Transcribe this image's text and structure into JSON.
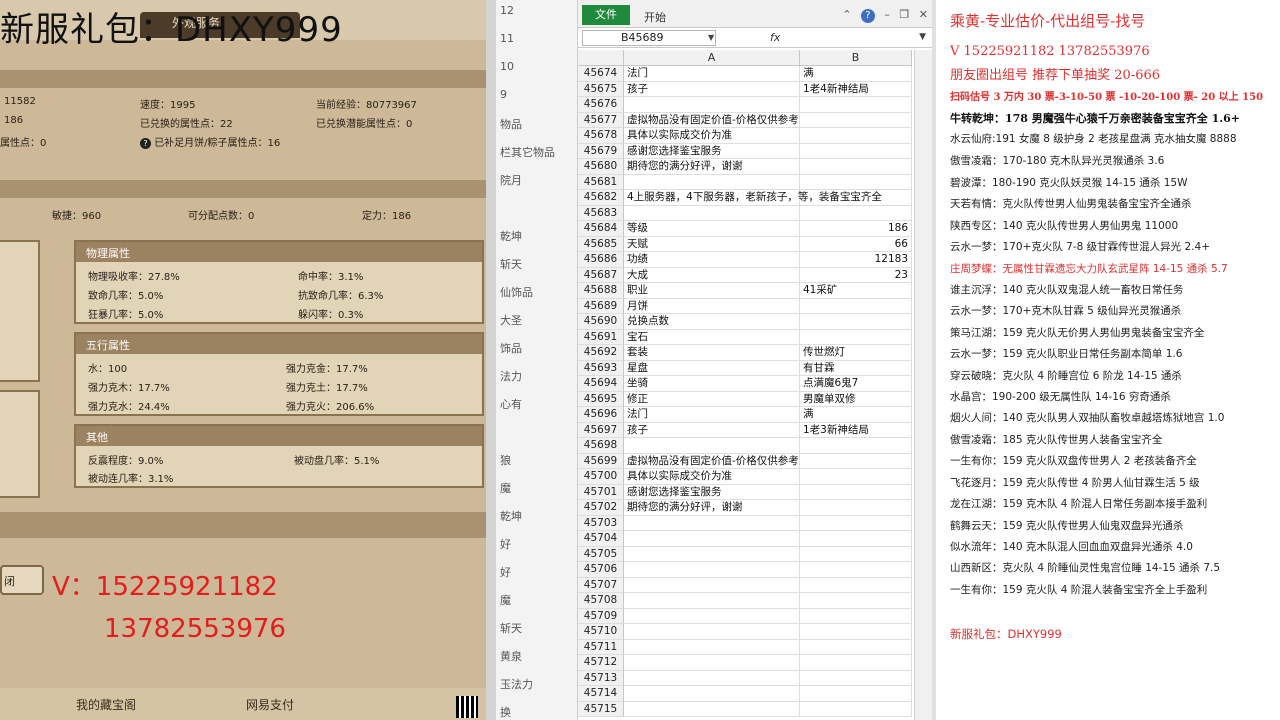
{
  "game": {
    "title": "新服礼包：DHXY999",
    "tab": "外观服务",
    "stats_row1": [
      "11582",
      "速度：1995",
      "当前经验：80773967"
    ],
    "stats_row2": [
      "186",
      "已兑换的属性点：22",
      "已兑换潜能属性点：0"
    ],
    "stats_row3": [
      "属性点：0",
      "已补足月饼/粽子属性点：16"
    ],
    "stats_row4": [
      "敏捷：960",
      "可分配点数：0",
      "定力：186"
    ],
    "physical": {
      "title": "物理属性",
      "items": [
        "物理吸收率：27.8%",
        "命中率：3.1%",
        "致命几率：5.0%",
        "抗致命几率：6.3%",
        "狂暴几率：5.0%",
        "躲闪率：0.3%"
      ]
    },
    "elements": {
      "title": "五行属性",
      "items": [
        "水：100",
        "强力克金：17.7%",
        "强力克木：17.7%",
        "强力克土：17.7%",
        "强力克水：24.4%",
        "强力克火：206.6%"
      ]
    },
    "other": {
      "title": "其他",
      "items": [
        "反震程度：9.0%",
        "被动盘几率：5.1%",
        "被动连几率：3.1%"
      ]
    },
    "close_label": "闭",
    "phone1": "V：15225921182",
    "phone2": "13782553976",
    "footer_left": "我的藏宝阁",
    "footer_right": "网易支付"
  },
  "strip": {
    "items": [
      "12",
      "11",
      "10",
      "9",
      "物品",
      "栏其它物品",
      "院月",
      "乾坤",
      "斩天",
      "仙饰品",
      "大圣",
      "饰品",
      "法力",
      "心有",
      "狼",
      "魔",
      "乾坤",
      "好",
      "好",
      "魔",
      "斩天",
      "黄泉",
      "玉法力",
      "换"
    ]
  },
  "excel": {
    "file_tab": "文件",
    "home_tab": "开始",
    "name_box": "B45689",
    "fx": "fx",
    "col_a": "A",
    "col_b": "B",
    "rows": [
      {
        "n": "45674",
        "a": "法门",
        "b": "满",
        "num": false
      },
      {
        "n": "45675",
        "a": "孩子",
        "b": "1老4新神结局",
        "num": false
      },
      {
        "n": "45676",
        "a": "",
        "b": "",
        "num": false
      },
      {
        "n": "45677",
        "a": "虚拟物品没有固定价值-价格仅供参考",
        "b": "",
        "num": false
      },
      {
        "n": "45678",
        "a": "具体以实际成交价为准",
        "b": "",
        "num": false
      },
      {
        "n": "45679",
        "a": "感谢您选择鉴宝服务",
        "b": "",
        "num": false
      },
      {
        "n": "45680",
        "a": "期待您的满分好评，谢谢",
        "b": "",
        "num": false
      },
      {
        "n": "45681",
        "a": "",
        "b": "",
        "num": false
      },
      {
        "n": "45682",
        "a": "4上服务器，4下服务器，老新孩子，等，装备宝宝齐全",
        "b": "",
        "num": false
      },
      {
        "n": "45683",
        "a": "",
        "b": "",
        "num": false
      },
      {
        "n": "45684",
        "a": "等级",
        "b": "186",
        "num": true
      },
      {
        "n": "45685",
        "a": "天赋",
        "b": "66",
        "num": true
      },
      {
        "n": "45686",
        "a": "功绩",
        "b": "12183",
        "num": true
      },
      {
        "n": "45687",
        "a": "大成",
        "b": "23",
        "num": true
      },
      {
        "n": "45688",
        "a": "职业",
        "b": "41采矿",
        "num": false
      },
      {
        "n": "45689",
        "a": "月饼",
        "b": "",
        "num": false
      },
      {
        "n": "45690",
        "a": "兑换点数",
        "b": "",
        "num": false
      },
      {
        "n": "45691",
        "a": "宝石",
        "b": "",
        "num": false
      },
      {
        "n": "45692",
        "a": "套装",
        "b": "传世燃灯",
        "num": false
      },
      {
        "n": "45693",
        "a": "星盘",
        "b": "有甘霖",
        "num": false
      },
      {
        "n": "45694",
        "a": "坐骑",
        "b": "点满魔6鬼7",
        "num": false
      },
      {
        "n": "45695",
        "a": "修正",
        "b": "男魔单双修",
        "num": false
      },
      {
        "n": "45696",
        "a": "法门",
        "b": "满",
        "num": false
      },
      {
        "n": "45697",
        "a": "孩子",
        "b": "1老3新神结局",
        "num": false
      },
      {
        "n": "45698",
        "a": "",
        "b": "",
        "num": false
      },
      {
        "n": "45699",
        "a": "虚拟物品没有固定价值-价格仅供参考",
        "b": "",
        "num": false
      },
      {
        "n": "45700",
        "a": "具体以实际成交价为准",
        "b": "",
        "num": false
      },
      {
        "n": "45701",
        "a": "感谢您选择鉴宝服务",
        "b": "",
        "num": false
      },
      {
        "n": "45702",
        "a": "期待您的满分好评，谢谢",
        "b": "",
        "num": false
      },
      {
        "n": "45703",
        "a": "",
        "b": "",
        "num": false
      },
      {
        "n": "45704",
        "a": "",
        "b": "",
        "num": false
      },
      {
        "n": "45705",
        "a": "",
        "b": "",
        "num": false
      },
      {
        "n": "45706",
        "a": "",
        "b": "",
        "num": false
      },
      {
        "n": "45707",
        "a": "",
        "b": "",
        "num": false
      },
      {
        "n": "45708",
        "a": "",
        "b": "",
        "num": false
      },
      {
        "n": "45709",
        "a": "",
        "b": "",
        "num": false
      },
      {
        "n": "45710",
        "a": "",
        "b": "",
        "num": false
      },
      {
        "n": "45711",
        "a": "",
        "b": "",
        "num": false
      },
      {
        "n": "45712",
        "a": "",
        "b": "",
        "num": false
      },
      {
        "n": "45713",
        "a": "",
        "b": "",
        "num": false
      },
      {
        "n": "45714",
        "a": "",
        "b": "",
        "num": false
      },
      {
        "n": "45715",
        "a": "",
        "b": "",
        "num": false
      }
    ]
  },
  "notes": {
    "lines": [
      {
        "text": "乘黄-专业估价-代出组号-找号",
        "color": "#e03030",
        "size": 15,
        "bold": false,
        "serif": true
      },
      {
        "text": "V   15225921182   13782553976",
        "color": "#e03030",
        "size": 13,
        "bold": false,
        "serif": true
      },
      {
        "text": "朋友圈出组号  推荐下单抽奖 20-666",
        "color": "#e03030",
        "size": 13,
        "bold": false,
        "serif": true
      },
      {
        "text": "扫码估号 3 万内 30 票-3-10-50 票 -10-20-100 票- 20 以上 150",
        "color": "#e03030",
        "size": 10,
        "bold": true,
        "serif": true
      },
      {
        "text": "牛转乾坤：178 男魔强牛心猿千万亲密装备宝宝齐全 1.6+",
        "color": "#111",
        "size": 11,
        "bold": true,
        "serif": true
      },
      {
        "text": "水云仙府:191 女魔 8 级护身 2 老孩星盘满 克水抽女魔 8888",
        "color": "#222",
        "size": 10.5,
        "bold": false,
        "serif": false
      },
      {
        "text": "傲雪凌霜：170-180 克木队异光灵猴通杀 3.6",
        "color": "#222",
        "size": 10.5,
        "bold": false,
        "serif": false
      },
      {
        "text": "碧波潭：180-190 克火队妖灵猴 14-15 通杀 15W",
        "color": "#222",
        "size": 10.5,
        "bold": false,
        "serif": false
      },
      {
        "text": "天若有情：克火队传世男人仙男鬼装备宝宝齐全通杀",
        "color": "#222",
        "size": 10.5,
        "bold": false,
        "serif": false
      },
      {
        "text": "陕西专区：140 克火队传世男人男仙男鬼 11000",
        "color": "#222",
        "size": 10.5,
        "bold": false,
        "serif": false
      },
      {
        "text": "云水一梦：170+克火队 7-8 级甘霖传世混人异光 2.4+",
        "color": "#222",
        "size": 10.5,
        "bold": false,
        "serif": false
      },
      {
        "text": "庄周梦蝶：无属性甘霖遗忘大力队玄武星阵 14-15 通杀 5.7",
        "color": "#e03030",
        "size": 10.5,
        "bold": false,
        "serif": false
      },
      {
        "text": "谁主沉浮：140 克火队双鬼混人统一畜牧日常任务",
        "color": "#222",
        "size": 10.5,
        "bold": false,
        "serif": false
      },
      {
        "text": "云水一梦：170+克木队甘霖 5 级仙异光灵猴通杀",
        "color": "#222",
        "size": 10.5,
        "bold": false,
        "serif": false
      },
      {
        "text": "策马江湖：159 克火队无价男人男仙男鬼装备宝宝齐全",
        "color": "#222",
        "size": 10.5,
        "bold": false,
        "serif": false
      },
      {
        "text": "云水一梦：159 克火队职业日常任务副本简单 1.6",
        "color": "#222",
        "size": 10.5,
        "bold": false,
        "serif": false
      },
      {
        "text": "穿云破晓：克火队 4 阶睡宫位 6 阶龙 14-15 通杀",
        "color": "#222",
        "size": 10.5,
        "bold": false,
        "serif": false
      },
      {
        "text": "水晶宫：190-200 级无属性队 14-16 穷奇通杀",
        "color": "#222",
        "size": 10.5,
        "bold": false,
        "serif": false
      },
      {
        "text": "烟火人间：140 克火队男人双抽队畜牧卓越塔炼狱地宫 1.0",
        "color": "#222",
        "size": 10.5,
        "bold": false,
        "serif": false
      },
      {
        "text": "傲雪凌霜：185 克火队传世男人装备宝宝齐全",
        "color": "#222",
        "size": 10.5,
        "bold": false,
        "serif": false
      },
      {
        "text": "一生有你：159 克火队双盘传世男人 2 老孩装备齐全",
        "color": "#222",
        "size": 10.5,
        "bold": false,
        "serif": false
      },
      {
        "text": "飞花逐月：159 克火队传世 4 阶男人仙甘霖生活 5 级",
        "color": "#222",
        "size": 10.5,
        "bold": false,
        "serif": false
      },
      {
        "text": "龙在江湖：159 克木队 4 阶混人日常任务副本接手盈利",
        "color": "#222",
        "size": 10.5,
        "bold": false,
        "serif": false
      },
      {
        "text": "鹤舞云天：159 克火队传世男人仙鬼双盘异光通杀",
        "color": "#222",
        "size": 10.5,
        "bold": false,
        "serif": false
      },
      {
        "text": "似水流年：140 克木队混人回血血双盘异光通杀 4.0",
        "color": "#222",
        "size": 10.5,
        "bold": false,
        "serif": false
      },
      {
        "text": "山西新区：克火队 4 阶睡仙灵性鬼宫位睡 14-15 通杀 7.5",
        "color": "#222",
        "size": 10.5,
        "bold": false,
        "serif": false
      },
      {
        "text": "一生有你：159 克火队 4 阶混人装备宝宝齐全上手盈利",
        "color": "#222",
        "size": 10.5,
        "bold": false,
        "serif": false
      },
      {
        "text": "",
        "color": "#222",
        "size": 10.5,
        "bold": false,
        "serif": false
      },
      {
        "text": "新服礼包：DHXY999",
        "color": "#e03030",
        "size": 11.5,
        "bold": false,
        "serif": false
      }
    ]
  }
}
